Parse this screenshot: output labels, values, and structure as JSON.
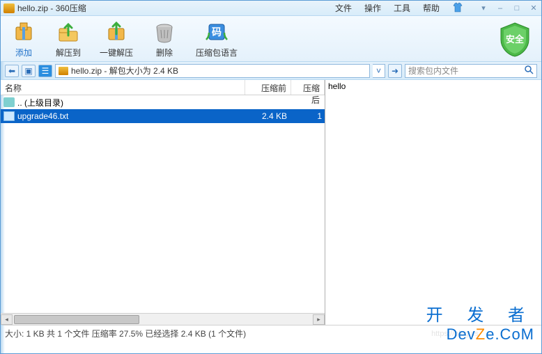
{
  "title": "hello.zip - 360压缩",
  "menus": {
    "file": "文件",
    "action": "操作",
    "tools": "工具",
    "help": "帮助"
  },
  "winbtns": {
    "min": "–",
    "max": "□",
    "close": "✕"
  },
  "toolbar": {
    "add": "添加",
    "extract_to": "解压到",
    "one_click": "一键解压",
    "delete": "删除",
    "language": "压缩包语言"
  },
  "shield_text": "安全",
  "path_text": "hello.zip - 解包大小为 2.4 KB",
  "search_placeholder": "搜索包内文件",
  "columns": {
    "name": "名称",
    "before": "压缩前",
    "after": "压缩后"
  },
  "rows": {
    "parent": ".. (上级目录)",
    "file_name": "upgrade46.txt",
    "file_before": "2.4 KB",
    "file_after": "1"
  },
  "preview_text": "hello",
  "status_text": "大小: 1 KB 共 1 个文件 压缩率 27.5% 已经选择 2.4 KB (1 个文件)",
  "watermark": {
    "cn": "开 发 者",
    "en_pre": "Dev",
    "en_mid": "Z",
    "en_post": "e.CoM"
  },
  "ghost_url": "https://blog.cs"
}
